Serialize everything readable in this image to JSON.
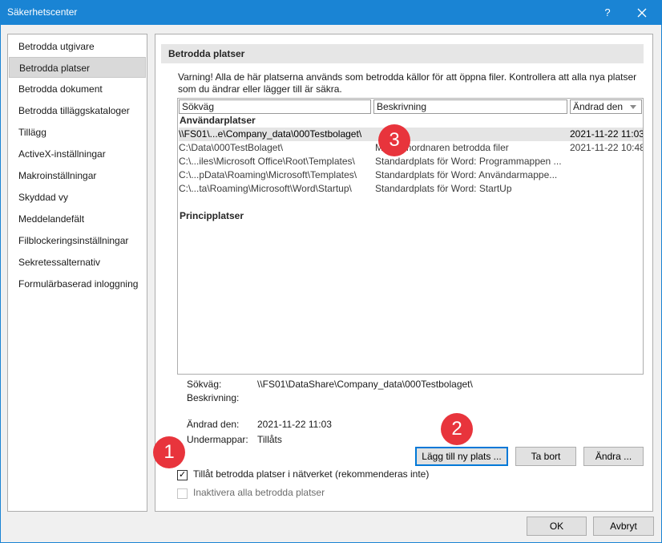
{
  "window": {
    "title": "Säkerhetscenter",
    "help_glyph": "?",
    "titlebar_color": "#1a84d4"
  },
  "sidebar": {
    "items": [
      {
        "label": "Betrodda utgivare"
      },
      {
        "label": "Betrodda platser",
        "selected": true
      },
      {
        "label": "Betrodda dokument"
      },
      {
        "label": "Betrodda tilläggskataloger"
      },
      {
        "label": "Tillägg"
      },
      {
        "label": "ActiveX-inställningar"
      },
      {
        "label": "Makroinställningar"
      },
      {
        "label": "Skyddad vy"
      },
      {
        "label": "Meddelandefält"
      },
      {
        "label": "Filblockeringsinställningar"
      },
      {
        "label": "Sekretessalternativ"
      },
      {
        "label": "Formulärbaserad inloggning"
      }
    ]
  },
  "main": {
    "section_title": "Betrodda platser",
    "warning_line1": "Varning! Alla de här platserna används som betrodda källor för att öppna filer. Kontrollera att alla nya platser",
    "warning_line2": "som du ändrar eller lägger till är säkra.",
    "columns": {
      "path": "Sökväg",
      "description": "Beskrivning",
      "modified": "Ändrad den"
    },
    "user_group_label": "Användarplatser",
    "user_rows": [
      {
        "path": "\\\\FS01\\...e\\Company_data\\000Testbolaget\\",
        "description": "",
        "modified": "2021-11-22 11:03",
        "selected": true
      },
      {
        "path": "C:\\Data\\000TestBolaget\\",
        "description": "M  Gsamordnaren betrodda filer",
        "modified": "2021-11-22 10:48"
      },
      {
        "path": "C:\\...iles\\Microsoft Office\\Root\\Templates\\",
        "description": "Standardplats för Word: Programmappen ...",
        "modified": ""
      },
      {
        "path": "C:\\...pData\\Roaming\\Microsoft\\Templates\\",
        "description": "Standardplats för Word: Användarmappe...",
        "modified": ""
      },
      {
        "path": "C:\\...ta\\Roaming\\Microsoft\\Word\\Startup\\",
        "description": "Standardplats för Word: StartUp",
        "modified": ""
      }
    ],
    "policy_group_label": "Principplatser",
    "details": {
      "path_label": "Sökväg:",
      "path_value": "\\\\FS01\\DataShare\\Company_data\\000Testbolaget\\",
      "description_label": "Beskrivning:",
      "description_value": "",
      "modified_label": "Ändrad den:",
      "modified_value": "2021-11-22 11:03",
      "subfolders_label": "Undermappar:",
      "subfolders_value": "Tillåts"
    },
    "buttons": {
      "add": "Lägg till ny plats ...",
      "remove": "Ta bort",
      "change": "Ändra ..."
    },
    "checkboxes": {
      "network": {
        "label": "Tillåt betrodda platser i nätverket (rekommenderas inte)",
        "checked": true
      },
      "disable_all": {
        "label": "Inaktivera alla betrodda platser",
        "checked": false
      }
    }
  },
  "footer": {
    "ok": "OK",
    "cancel": "Avbryt"
  },
  "annotations": {
    "callout_1": "1",
    "callout_2": "2",
    "callout_3": "3",
    "callout_color": "#e8343c"
  },
  "icons": {
    "close": "close-icon",
    "sort": "sort-descending-icon",
    "check": "checkmark-icon"
  }
}
